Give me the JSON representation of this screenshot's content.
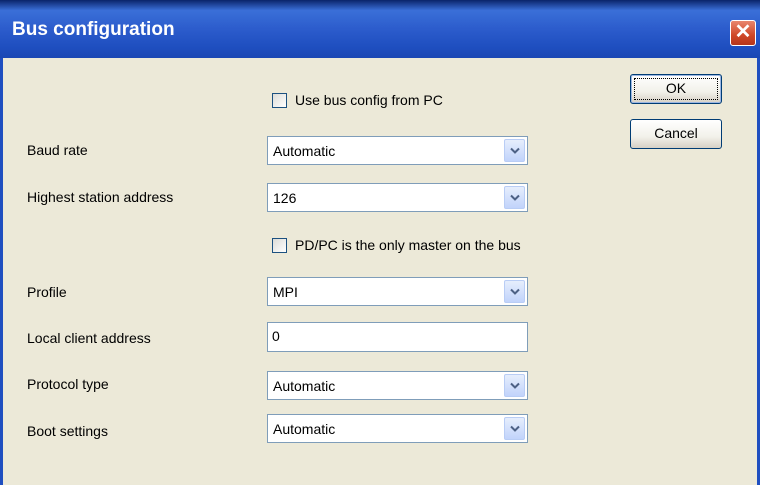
{
  "window": {
    "title": "Bus configuration",
    "close_symbol": "✕"
  },
  "buttons": {
    "ok": "OK",
    "cancel": "Cancel"
  },
  "use_bus_config": {
    "label": "Use bus config from PC",
    "checked": false
  },
  "baud_rate": {
    "label": "Baud rate",
    "value": "Automatic"
  },
  "highest_station_address": {
    "label": "Highest station address",
    "value": "126"
  },
  "only_master": {
    "label": "PD/PC is the only master on the bus",
    "checked": false
  },
  "profile": {
    "label": "Profile",
    "value": "MPI"
  },
  "local_client_address": {
    "label": "Local client address",
    "value": "0"
  },
  "protocol_type": {
    "label": "Protocol type",
    "value": "Automatic"
  },
  "boot_settings": {
    "label": "Boot settings",
    "value": "Automatic"
  },
  "colors": {
    "titlebar": "#2c5ccc",
    "dialog_bg": "#ece9d8",
    "close_button": "#cf4727",
    "field_border": "#7f9db9"
  },
  "icons": {
    "close": "close-icon",
    "dropdown": "chevron-down-icon"
  }
}
